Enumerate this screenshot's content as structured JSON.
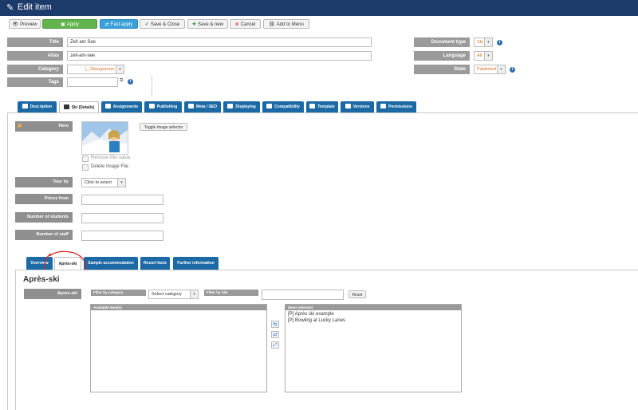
{
  "window": {
    "title": "Edit item"
  },
  "toolbar": {
    "preview": "Preview",
    "apply": "Apply",
    "fast_apply": "Fast apply",
    "save_close": "Save & Close",
    "save_new": "Save & new",
    "cancel": "Cancel",
    "add_menu": "Add to Menu"
  },
  "fields": {
    "title_label": "Title",
    "title_value": "Zell am See",
    "alias_label": "Alias",
    "alias_value": "zell-am-see",
    "category_label": "Category",
    "category_value": "|_ Skiorganizer",
    "tags_label": "Tags",
    "doctype_label": "Document type",
    "doctype_value": "Ski",
    "language_label": "Language",
    "language_value": "All",
    "state_label": "State",
    "state_value": "Published"
  },
  "tabs": [
    {
      "label": "Description"
    },
    {
      "label": "Ski (Details)"
    },
    {
      "label": "Assignments"
    },
    {
      "label": "Publishing"
    },
    {
      "label": "Meta / SEO"
    },
    {
      "label": "Displaying"
    },
    {
      "label": "Compatibility"
    },
    {
      "label": "Template"
    },
    {
      "label": "Versions"
    },
    {
      "label": "Permissions"
    }
  ],
  "details": {
    "hero_label": "Hero",
    "toggle_selector": "Toggle image selector",
    "remove_value": "Remove this value",
    "delete_image": "Delete Image File",
    "tour_by_label": "Tour by",
    "tour_by_value": "Click to select",
    "prices_label": "Prices from",
    "students_label": "Number of students",
    "staff_label": "Number of staff"
  },
  "subtabs": [
    {
      "label": "Overview"
    },
    {
      "label": "Après-ski"
    },
    {
      "label": "Sample accommodation"
    },
    {
      "label": "Resort facts"
    },
    {
      "label": "Further information"
    }
  ],
  "apres": {
    "heading": "Après-ski",
    "field_label": "Après-ski",
    "filter_category": "Filter by category",
    "category_placeholder": "Select category",
    "filter_title": "Filter by title",
    "reset": "Reset",
    "available_header": "Available Item(s)",
    "selected_header": "Items selected",
    "selected_items": [
      "[P] Après ski example",
      "[P] Bowling at Lucky Lanes"
    ]
  },
  "colors": {
    "header_bg": "#1d3b6a",
    "tab_bg": "#1b6aa5",
    "apply_green": "#62b44d",
    "annotation_red": "#e02020"
  }
}
